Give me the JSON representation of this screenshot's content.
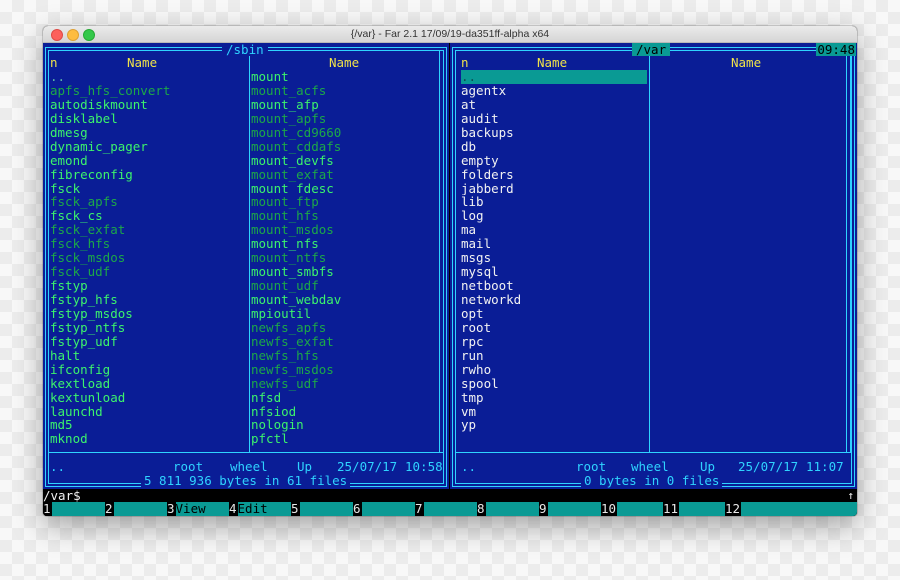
{
  "window": {
    "title": "{/var} - Far 2.1 17/09/19-da351ff-alpha x64"
  },
  "clock": "09:48",
  "left_panel": {
    "path": "/sbin",
    "col_n_label": "n",
    "columns": [
      {
        "header": "Name"
      },
      {
        "header": "Name"
      }
    ],
    "column1": [
      {
        "name": "..",
        "style": "updim"
      },
      {
        "name": "apfs_hfs_convert",
        "style": "dim"
      },
      {
        "name": "autodiskmount",
        "style": "bright"
      },
      {
        "name": "disklabel",
        "style": "bright"
      },
      {
        "name": "dmesg",
        "style": "bright"
      },
      {
        "name": "dynamic_pager",
        "style": "bright"
      },
      {
        "name": "emond",
        "style": "bright"
      },
      {
        "name": "fibreconfig",
        "style": "bright"
      },
      {
        "name": "fsck",
        "style": "bright"
      },
      {
        "name": "fsck_apfs",
        "style": "dim"
      },
      {
        "name": "fsck_cs",
        "style": "bright"
      },
      {
        "name": "fsck_exfat",
        "style": "dim"
      },
      {
        "name": "fsck_hfs",
        "style": "dim"
      },
      {
        "name": "fsck_msdos",
        "style": "dim"
      },
      {
        "name": "fsck_udf",
        "style": "dim"
      },
      {
        "name": "fstyp",
        "style": "bright"
      },
      {
        "name": "fstyp_hfs",
        "style": "bright"
      },
      {
        "name": "fstyp_msdos",
        "style": "bright"
      },
      {
        "name": "fstyp_ntfs",
        "style": "bright"
      },
      {
        "name": "fstyp_udf",
        "style": "bright"
      },
      {
        "name": "halt",
        "style": "bright"
      },
      {
        "name": "ifconfig",
        "style": "bright"
      },
      {
        "name": "kextload",
        "style": "bright"
      },
      {
        "name": "kextunload",
        "style": "bright"
      },
      {
        "name": "launchd",
        "style": "bright"
      },
      {
        "name": "md5",
        "style": "bright"
      },
      {
        "name": "mknod",
        "style": "bright"
      }
    ],
    "column2": [
      {
        "name": "mount",
        "style": "bright"
      },
      {
        "name": "mount_acfs",
        "style": "dim"
      },
      {
        "name": "mount_afp",
        "style": "bright"
      },
      {
        "name": "mount_apfs",
        "style": "dim"
      },
      {
        "name": "mount_cd9660",
        "style": "dim"
      },
      {
        "name": "mount_cddafs",
        "style": "dim"
      },
      {
        "name": "mount_devfs",
        "style": "bright"
      },
      {
        "name": "mount_exfat",
        "style": "dim"
      },
      {
        "name": "mount_fdesc",
        "style": "bright"
      },
      {
        "name": "mount_ftp",
        "style": "dim"
      },
      {
        "name": "mount_hfs",
        "style": "dim"
      },
      {
        "name": "mount_msdos",
        "style": "dim"
      },
      {
        "name": "mount_nfs",
        "style": "bright"
      },
      {
        "name": "mount_ntfs",
        "style": "dim"
      },
      {
        "name": "mount_smbfs",
        "style": "bright"
      },
      {
        "name": "mount_udf",
        "style": "dim"
      },
      {
        "name": "mount_webdav",
        "style": "bright"
      },
      {
        "name": "mpioutil",
        "style": "bright"
      },
      {
        "name": "newfs_apfs",
        "style": "dim"
      },
      {
        "name": "newfs_exfat",
        "style": "dim"
      },
      {
        "name": "newfs_hfs",
        "style": "dim"
      },
      {
        "name": "newfs_msdos",
        "style": "dim"
      },
      {
        "name": "newfs_udf",
        "style": "dim"
      },
      {
        "name": "nfsd",
        "style": "bright"
      },
      {
        "name": "nfsiod",
        "style": "bright"
      },
      {
        "name": "nologin",
        "style": "bright"
      },
      {
        "name": "pfctl",
        "style": "bright"
      }
    ],
    "status": {
      "name": "..",
      "owner": "root",
      "group": "wheel",
      "type": "Up",
      "date": "25/07/17",
      "time": "10:58"
    },
    "summary": "5 811 936 bytes in 61 files"
  },
  "right_panel": {
    "path": "/var",
    "col_n_label": "n",
    "columns": [
      {
        "header": "Name"
      },
      {
        "header": "Name"
      }
    ],
    "column1": [
      {
        "name": "..",
        "style": "selected"
      },
      {
        "name": "agentx",
        "style": "white"
      },
      {
        "name": "at",
        "style": "white"
      },
      {
        "name": "audit",
        "style": "white"
      },
      {
        "name": "backups",
        "style": "white"
      },
      {
        "name": "db",
        "style": "white"
      },
      {
        "name": "empty",
        "style": "white"
      },
      {
        "name": "folders",
        "style": "white"
      },
      {
        "name": "jabberd",
        "style": "white"
      },
      {
        "name": "lib",
        "style": "white"
      },
      {
        "name": "log",
        "style": "white"
      },
      {
        "name": "ma",
        "style": "white"
      },
      {
        "name": "mail",
        "style": "white"
      },
      {
        "name": "msgs",
        "style": "white"
      },
      {
        "name": "mysql",
        "style": "white"
      },
      {
        "name": "netboot",
        "style": "white"
      },
      {
        "name": "networkd",
        "style": "white"
      },
      {
        "name": "opt",
        "style": "white"
      },
      {
        "name": "root",
        "style": "white"
      },
      {
        "name": "rpc",
        "style": "white"
      },
      {
        "name": "run",
        "style": "white"
      },
      {
        "name": "rwho",
        "style": "white"
      },
      {
        "name": "spool",
        "style": "white"
      },
      {
        "name": "tmp",
        "style": "white"
      },
      {
        "name": "vm",
        "style": "white"
      },
      {
        "name": "yp",
        "style": "white"
      }
    ],
    "column2": [],
    "status": {
      "name": "..",
      "owner": "root",
      "group": "wheel",
      "type": "Up",
      "date": "25/07/17",
      "time": "11:07"
    },
    "summary": "0 bytes in 0 files"
  },
  "command_line": {
    "prompt": "/var$",
    "scroll_indicator": "↑"
  },
  "keybar": [
    {
      "num": "1",
      "label": ""
    },
    {
      "num": "2",
      "label": ""
    },
    {
      "num": "3",
      "label": "View"
    },
    {
      "num": "4",
      "label": "Edit"
    },
    {
      "num": "5",
      "label": ""
    },
    {
      "num": "6",
      "label": ""
    },
    {
      "num": "7",
      "label": ""
    },
    {
      "num": "8",
      "label": ""
    },
    {
      "num": "9",
      "label": ""
    },
    {
      "num": "10",
      "label": ""
    },
    {
      "num": "11",
      "label": ""
    },
    {
      "num": "12",
      "label": ""
    }
  ],
  "colors": {
    "panel_bg": "#0a1d96",
    "border": "#2fd3ff",
    "header": "#f0e24a",
    "exec_bright": "#3cf36c",
    "exec_dim": "#1ca848",
    "dir": "#f2f2f2",
    "highlight": "#0a9a94"
  }
}
